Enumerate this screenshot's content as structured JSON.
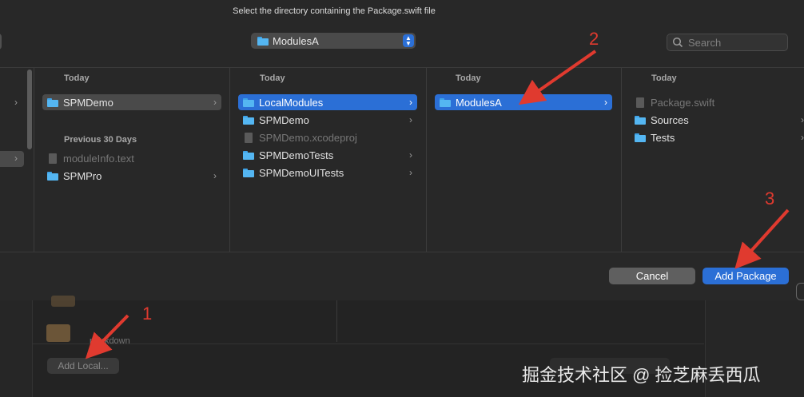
{
  "dialog": {
    "title": "Select the directory containing the Package.swift file",
    "location": "ModulesA",
    "search_placeholder": "Search"
  },
  "columns": [
    {
      "sections": [
        {
          "header": "Today",
          "items": [
            {
              "label": "SPMDemo",
              "icon": "folder-icon",
              "selected": "inactive",
              "chevron": true
            }
          ]
        },
        {
          "header": "Previous 30 Days",
          "items": [
            {
              "label": "moduleInfo.text",
              "icon": "file-icon",
              "dim": true
            },
            {
              "label": "SPMPro",
              "icon": "folder-icon",
              "chevron": true
            }
          ]
        }
      ]
    },
    {
      "sections": [
        {
          "header": "Today",
          "items": [
            {
              "label": "LocalModules",
              "icon": "folder-icon",
              "selected": "active",
              "chevron": true
            },
            {
              "label": "SPMDemo",
              "icon": "folder-icon",
              "chevron": true
            },
            {
              "label": "SPMDemo.xcodeproj",
              "icon": "xcodeproj-icon",
              "dim": true
            },
            {
              "label": "SPMDemoTests",
              "icon": "folder-icon",
              "chevron": true
            },
            {
              "label": "SPMDemoUITests",
              "icon": "folder-icon",
              "chevron": true
            }
          ]
        }
      ]
    },
    {
      "sections": [
        {
          "header": "Today",
          "items": [
            {
              "label": "ModulesA",
              "icon": "folder-icon",
              "selected": "active",
              "chevron": true
            }
          ]
        }
      ]
    },
    {
      "sections": [
        {
          "header": "Today",
          "items": [
            {
              "label": "Package.swift",
              "icon": "file-icon",
              "dim": true
            },
            {
              "label": "Sources",
              "icon": "folder-icon",
              "chevron": true
            },
            {
              "label": "Tests",
              "icon": "folder-icon",
              "chevron": true
            }
          ]
        }
      ]
    }
  ],
  "buttons": {
    "cancel": "Cancel",
    "add_package": "Add Package"
  },
  "background": {
    "add_local": "Add Local...",
    "item_text": "markdown"
  },
  "annotations": {
    "n1": "1",
    "n2": "2",
    "n3": "3",
    "color": "#e03a2f"
  },
  "watermark": "掘金技术社区 @ 捡芝麻丢西瓜",
  "colors": {
    "accent": "#2b6fd6",
    "folder": "#54b6f2",
    "dialog_bg": "#282828"
  }
}
